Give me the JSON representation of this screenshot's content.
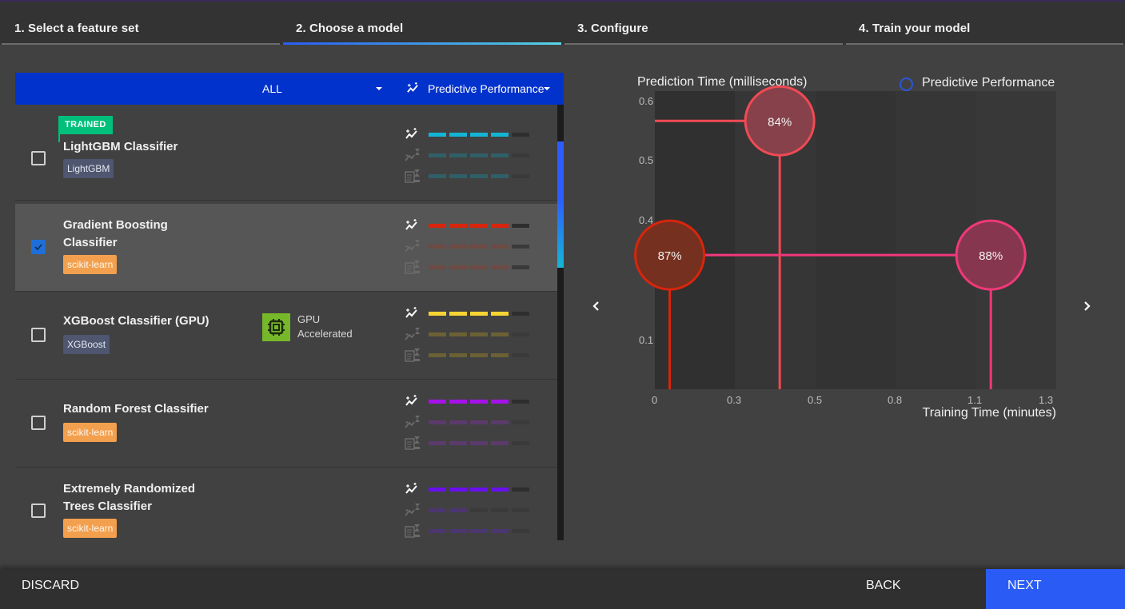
{
  "stepper": {
    "steps": [
      {
        "label": "1. Select a feature set",
        "active": false
      },
      {
        "label": "2. Choose a model",
        "active": true
      },
      {
        "label": "3. Configure",
        "active": false
      },
      {
        "label": "4. Train your model",
        "active": false
      }
    ]
  },
  "list": {
    "filter": {
      "value": "ALL",
      "icon": "chevron-down-icon"
    },
    "metric": {
      "value": "Predictive Performance",
      "icon": "performance-trend-icon"
    },
    "metric_icons": [
      "predictive-performance-icon",
      "training-time-icon",
      "prediction-time-icon"
    ],
    "models": [
      {
        "name": "LightGBM Classifier",
        "library": "LightGBM",
        "library_style": "lgbm",
        "trained_badge": "TRAINED",
        "checked": false,
        "selected": false,
        "color": "#12b5d3",
        "dim_color": "#2f6068",
        "ratings": {
          "predictive_performance": 4,
          "training_time": 4,
          "prediction_time": 4
        },
        "max_rating": 5
      },
      {
        "name": "Gradient Boosting Classifier",
        "library": "scikit-learn",
        "library_style": "sk",
        "checked": true,
        "selected": true,
        "color": "#d8250c",
        "dim_color": "#6e4a44",
        "ratings": {
          "predictive_performance": 4,
          "training_time": 4,
          "prediction_time": 4
        },
        "max_rating": 5
      },
      {
        "name": "XGBoost Classifier (GPU)",
        "library": "XGBoost",
        "library_style": "xgb",
        "checked": false,
        "selected": false,
        "gpu": {
          "line1": "GPU",
          "line2": "Accelerated",
          "icon": "gpu-chip-icon",
          "color": "#76b82a"
        },
        "color": "#f7d432",
        "dim_color": "#6b6134",
        "ratings": {
          "predictive_performance": 4,
          "training_time": 4,
          "prediction_time": 4
        },
        "max_rating": 5
      },
      {
        "name": "Random Forest Classifier",
        "library": "scikit-learn",
        "library_style": "sk",
        "checked": false,
        "selected": false,
        "color": "#a511e8",
        "dim_color": "#5b3a6c",
        "ratings": {
          "predictive_performance": 4,
          "training_time": 4,
          "prediction_time": 4
        },
        "max_rating": 5
      },
      {
        "name": "Extremely Randomized Trees Classifier",
        "library": "scikit-learn",
        "library_style": "sk",
        "checked": false,
        "selected": false,
        "color": "#6a0ff0",
        "dim_color": "#4b3670",
        "ratings": {
          "predictive_performance": 4,
          "training_time": 2,
          "prediction_time": 4
        },
        "max_rating": 5
      }
    ],
    "scroll_position": 0.2
  },
  "chart_data": {
    "type": "scatter",
    "title": "",
    "ylabel": "Prediction Time (milliseconds)",
    "xlabel": "Training Time (minutes)",
    "legend": {
      "label": "Predictive Performance",
      "placement": "top-right"
    },
    "x_ticks": [
      "0",
      "0.3",
      "0.5",
      "0.8",
      "1.1",
      "1.3"
    ],
    "y_ticks": [
      "0.1",
      "0.4",
      "0.5",
      "0.6"
    ],
    "xlim": [
      0,
      1.35
    ],
    "ylim": [
      0,
      0.6
    ],
    "points": [
      {
        "label": "84%",
        "x": 0.42,
        "y": 0.54,
        "stroke": "#f04a55",
        "fill": "#86414a",
        "model": "LightGBM Classifier"
      },
      {
        "label": "87%",
        "x": 0.05,
        "y": 0.27,
        "stroke": "#d8250c",
        "fill": "#76301f",
        "model": "Gradient Boosting Classifier"
      },
      {
        "label": "88%",
        "x": 1.13,
        "y": 0.27,
        "stroke": "#f0387a",
        "fill": "#86374f",
        "model": "selected model"
      }
    ]
  },
  "chart_nav": {
    "prev_icon": "chevron-left-icon",
    "next_icon": "chevron-right-icon"
  },
  "footer": {
    "discard": "DISCARD",
    "back": "BACK",
    "next": "NEXT"
  }
}
